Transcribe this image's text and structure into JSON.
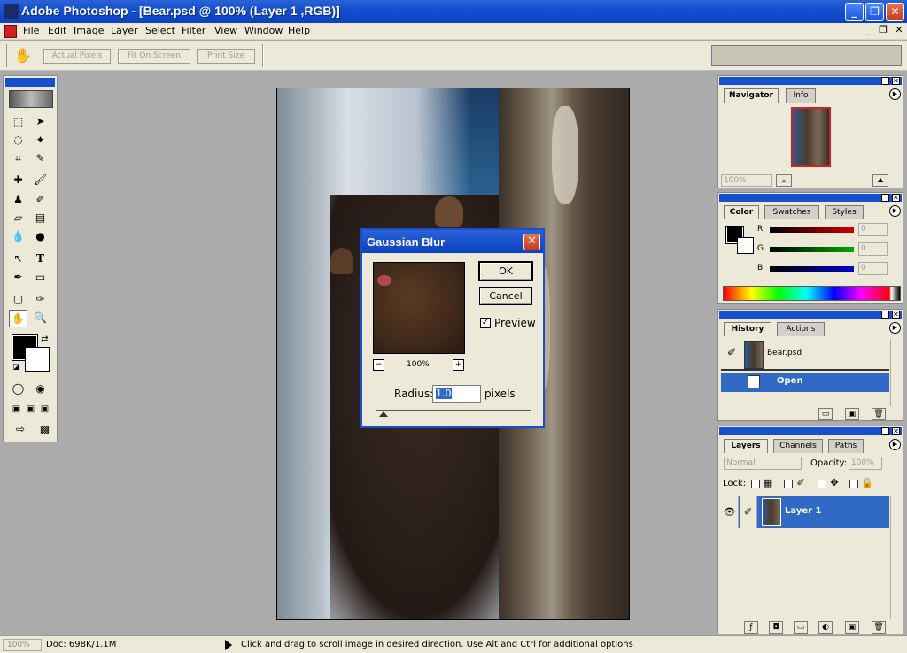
{
  "window": {
    "title": "Adobe Photoshop - [Bear.psd @ 100% (Layer 1 ,RGB)]",
    "min": "_",
    "max": "❐",
    "close": "✕"
  },
  "menu": [
    "File",
    "Edit",
    "Image",
    "Layer",
    "Select",
    "Filter",
    "View",
    "Window",
    "Help"
  ],
  "mdi": {
    "min": "_",
    "restore": "❐",
    "close": "✕"
  },
  "options": {
    "buttons": [
      "Actual Pixels",
      "Fit On Screen",
      "Print Size"
    ]
  },
  "dialog": {
    "title": "Gaussian Blur",
    "ok": "OK",
    "cancel": "Cancel",
    "preview_label": "Preview",
    "preview_checked": true,
    "zoom": "100%",
    "radius_label": "Radius:",
    "radius_value": "1.0",
    "radius_unit": "pixels",
    "zoom_out": "−",
    "zoom_in": "+"
  },
  "navigator": {
    "tabs": [
      "Navigator",
      "Info"
    ],
    "zoom": "100%"
  },
  "color": {
    "tabs": [
      "Color",
      "Swatches",
      "Styles"
    ],
    "channels": [
      {
        "label": "R",
        "value": "0",
        "color": "#cc0000"
      },
      {
        "label": "G",
        "value": "0",
        "color": "#00aa00"
      },
      {
        "label": "B",
        "value": "0",
        "color": "#0000cc"
      }
    ]
  },
  "history": {
    "tabs": [
      "History",
      "Actions"
    ],
    "snapshot": "Bear.psd",
    "step": "Open"
  },
  "layers": {
    "tabs": [
      "Layers",
      "Channels",
      "Paths"
    ],
    "blend_mode": "Normal",
    "opacity_label": "Opacity:",
    "opacity": "100%",
    "lock_label": "Lock:",
    "layer_name": "Layer 1"
  },
  "status": {
    "zoom": "100%",
    "doc": "Doc: 698K/1.1M",
    "hint": "Click and drag to scroll image in desired direction.  Use Alt and Ctrl for additional options"
  },
  "icons": {
    "hand": "hand-icon",
    "eye": "eye-icon",
    "brush": "brush-icon",
    "check": "✓"
  },
  "colors": {
    "titlebar": "#1450D0",
    "selection": "#316AC5",
    "chrome": "#ECE9D8",
    "workspace": "#ABABAB"
  }
}
